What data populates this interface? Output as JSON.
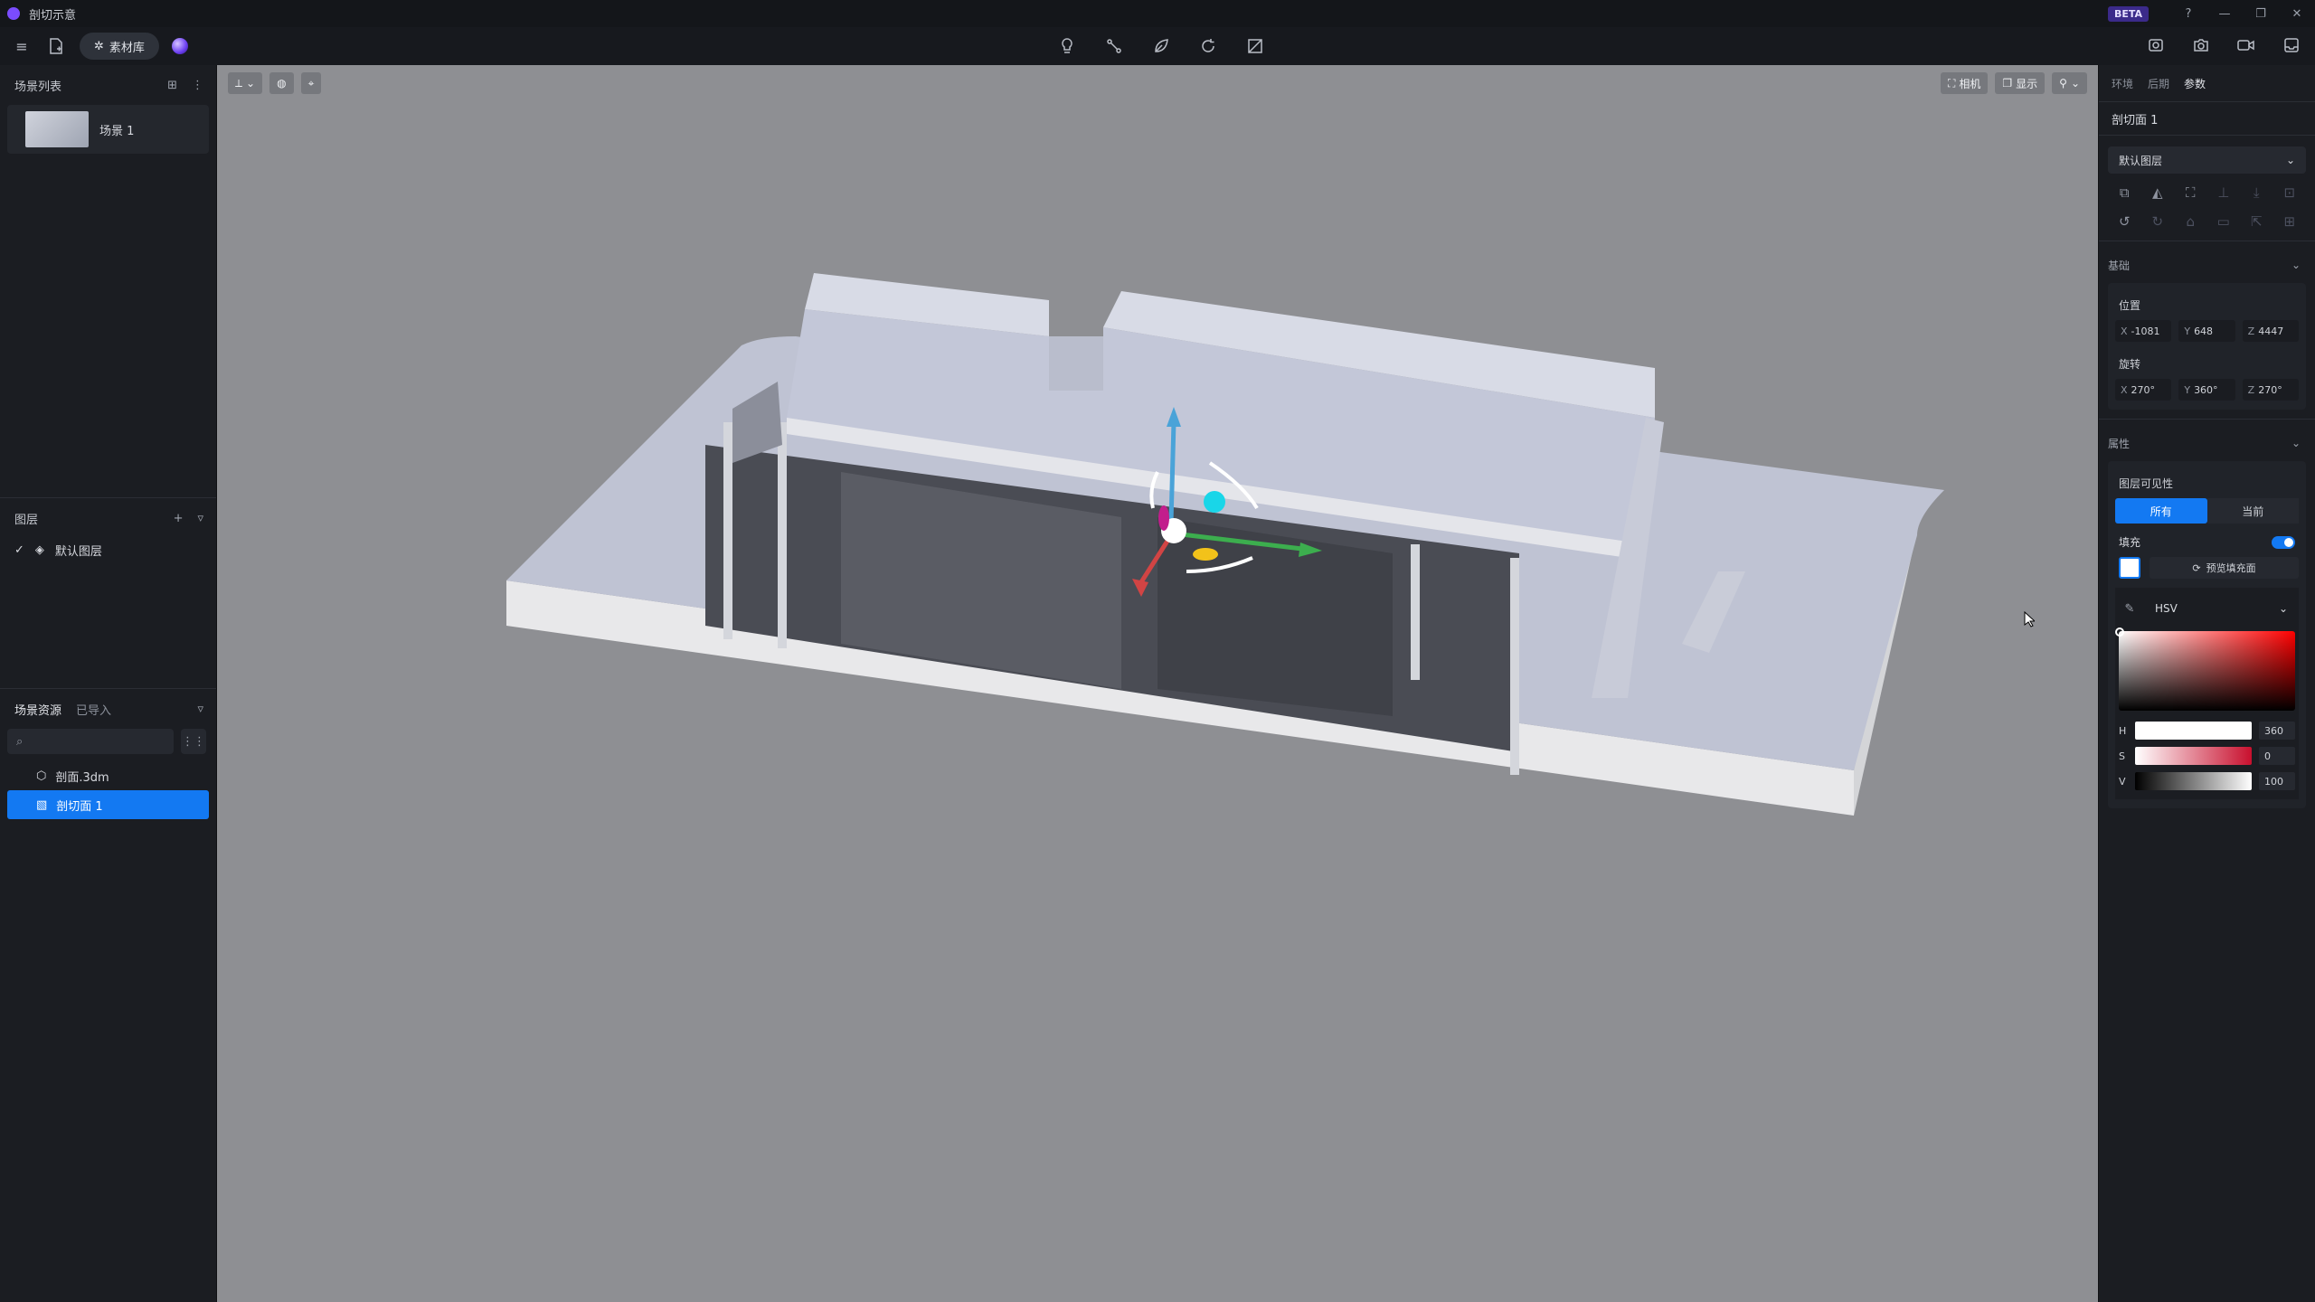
{
  "window": {
    "title": "剖切示意",
    "beta": "BETA",
    "controls": [
      "?",
      "—",
      "❐",
      "✕"
    ]
  },
  "toolbar": {
    "library_label": "素材库"
  },
  "left": {
    "scene_list_title": "场景列表",
    "scenes": [
      {
        "name": "场景 1"
      }
    ],
    "layers_title": "图层",
    "layers": [
      {
        "name": "默认图层"
      }
    ],
    "asset_tabs": [
      "场景资源",
      "已导入"
    ],
    "assets": [
      {
        "name": "剖面.3dm",
        "selected": false
      },
      {
        "name": "剖切面 1",
        "selected": true
      }
    ]
  },
  "viewport": {
    "camera_label": "相机",
    "display_label": "显示"
  },
  "right": {
    "tabs": [
      "环境",
      "后期",
      "参数"
    ],
    "active_tab": 2,
    "object_title": "剖切面 1",
    "layer_dropdown": "默认图层",
    "basic_title": "基础",
    "position_label": "位置",
    "position": {
      "x": "-1081",
      "y": "648",
      "z": "4447"
    },
    "rotation_label": "旋转",
    "rotation": {
      "x": "270°",
      "y": "360°",
      "z": "270°"
    },
    "attributes_title": "属性",
    "layer_visibility_label": "图层可见性",
    "visibility_options": [
      "所有",
      "当前"
    ],
    "fill_label": "填充",
    "fill_enabled": true,
    "fill_color": "#ffffff",
    "preview_fill_label": "预览填充面",
    "color_mode": "HSV",
    "hsv": {
      "h": "360",
      "s": "0",
      "v": "100"
    }
  },
  "colors": {
    "accent": "#1379f2",
    "viewport_bg": "#8e8f93",
    "panel_bg": "#1b1d22"
  }
}
